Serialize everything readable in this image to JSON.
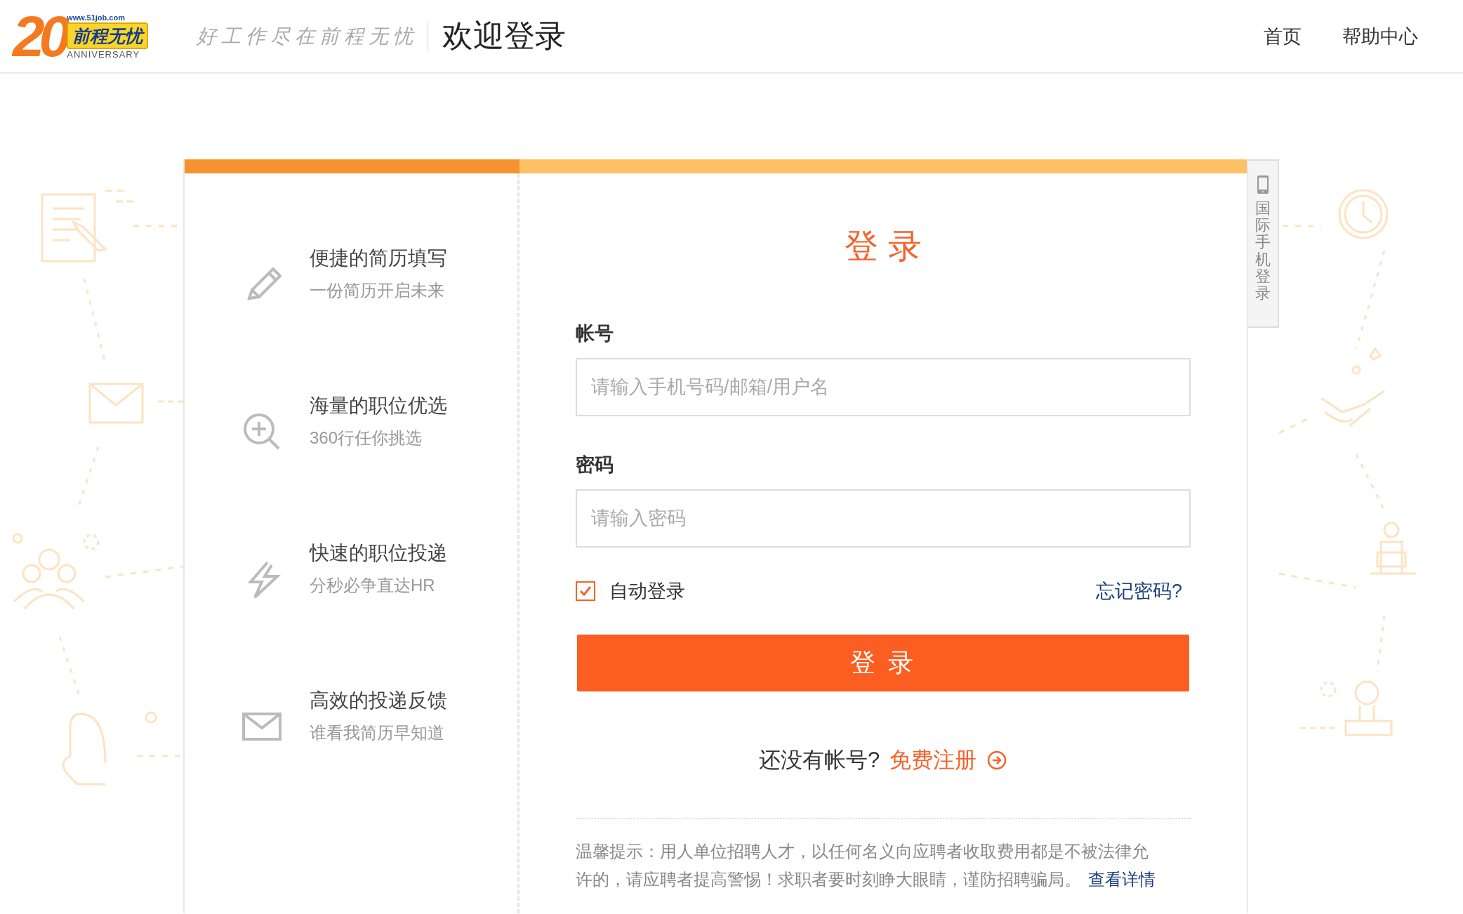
{
  "header": {
    "logo": {
      "number": "20",
      "site": "www.51job.com",
      "brand": "前程无忧",
      "tagline": "ANNIVERSARY"
    },
    "slogan": "好工作尽在前程无忧",
    "title": "欢迎登录",
    "nav": [
      {
        "label": "首页"
      },
      {
        "label": "帮助中心"
      }
    ]
  },
  "features": [
    {
      "kind": "pencil",
      "title": "便捷的简历填写",
      "subtitle": "一份简历开启未来"
    },
    {
      "kind": "zoom",
      "title": "海量的职位优选",
      "subtitle": "360行任你挑选"
    },
    {
      "kind": "bolt",
      "title": "快速的职位投递",
      "subtitle": "分秒必争直达HR"
    },
    {
      "kind": "mail",
      "title": "高效的投递反馈",
      "subtitle": "谁看我简历早知道"
    }
  ],
  "login": {
    "title": "登 录",
    "fields": [
      {
        "label": "帐号",
        "placeholder": "请输入手机号码/邮箱/用户名"
      },
      {
        "label": "密码",
        "placeholder": "请输入密码"
      }
    ],
    "remember": {
      "label": "自动登录",
      "checked": true
    },
    "forgot": "忘记密码?",
    "submit": "登 录",
    "register": {
      "prompt": "还没有帐号?",
      "link": "免费注册"
    },
    "notice": {
      "text": "温馨提示：用人单位招聘人才，以任何名义向应聘者收取费用都是不被法律允许的，请应聘者提高警惕！求职者要时刻睁大眼睛，谨防招聘骗局。",
      "link": "查看详情"
    }
  },
  "side_tab": {
    "label": "国际手机登录"
  }
}
